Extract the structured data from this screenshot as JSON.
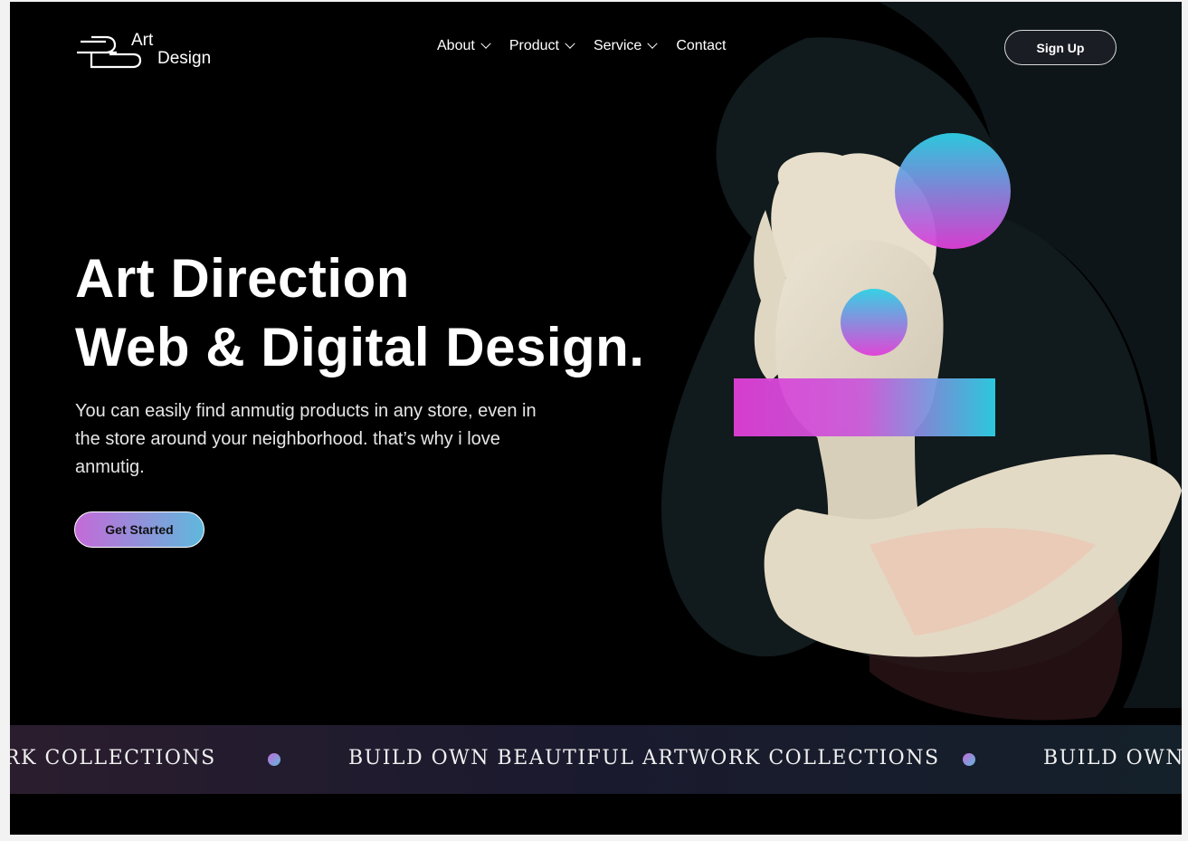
{
  "brand": {
    "line1": "Art",
    "line2": "Design"
  },
  "nav": {
    "items": [
      {
        "label": "About",
        "dropdown": true
      },
      {
        "label": "Product",
        "dropdown": true
      },
      {
        "label": "Service",
        "dropdown": true
      },
      {
        "label": "Contact",
        "dropdown": false
      }
    ],
    "signup_label": "Sign Up"
  },
  "hero": {
    "title_line1": "Art Direction",
    "title_line2": "Web & Digital Design.",
    "lead": "You can easily find anmutig products in any store, even in the store around your neighborhood. that’s why i love anmutig.",
    "cta_label": "Get Started"
  },
  "marquee": {
    "text_partial": "RK COLLECTIONS",
    "text_full": "BUILD OWN BEAUTIFUL ARTWORK COLLECTIONS",
    "text_partial_end": "BUILD OWN B"
  },
  "colors": {
    "gradient_pink": "#d946ef",
    "gradient_cyan": "#22d3ee",
    "background": "#000000"
  }
}
